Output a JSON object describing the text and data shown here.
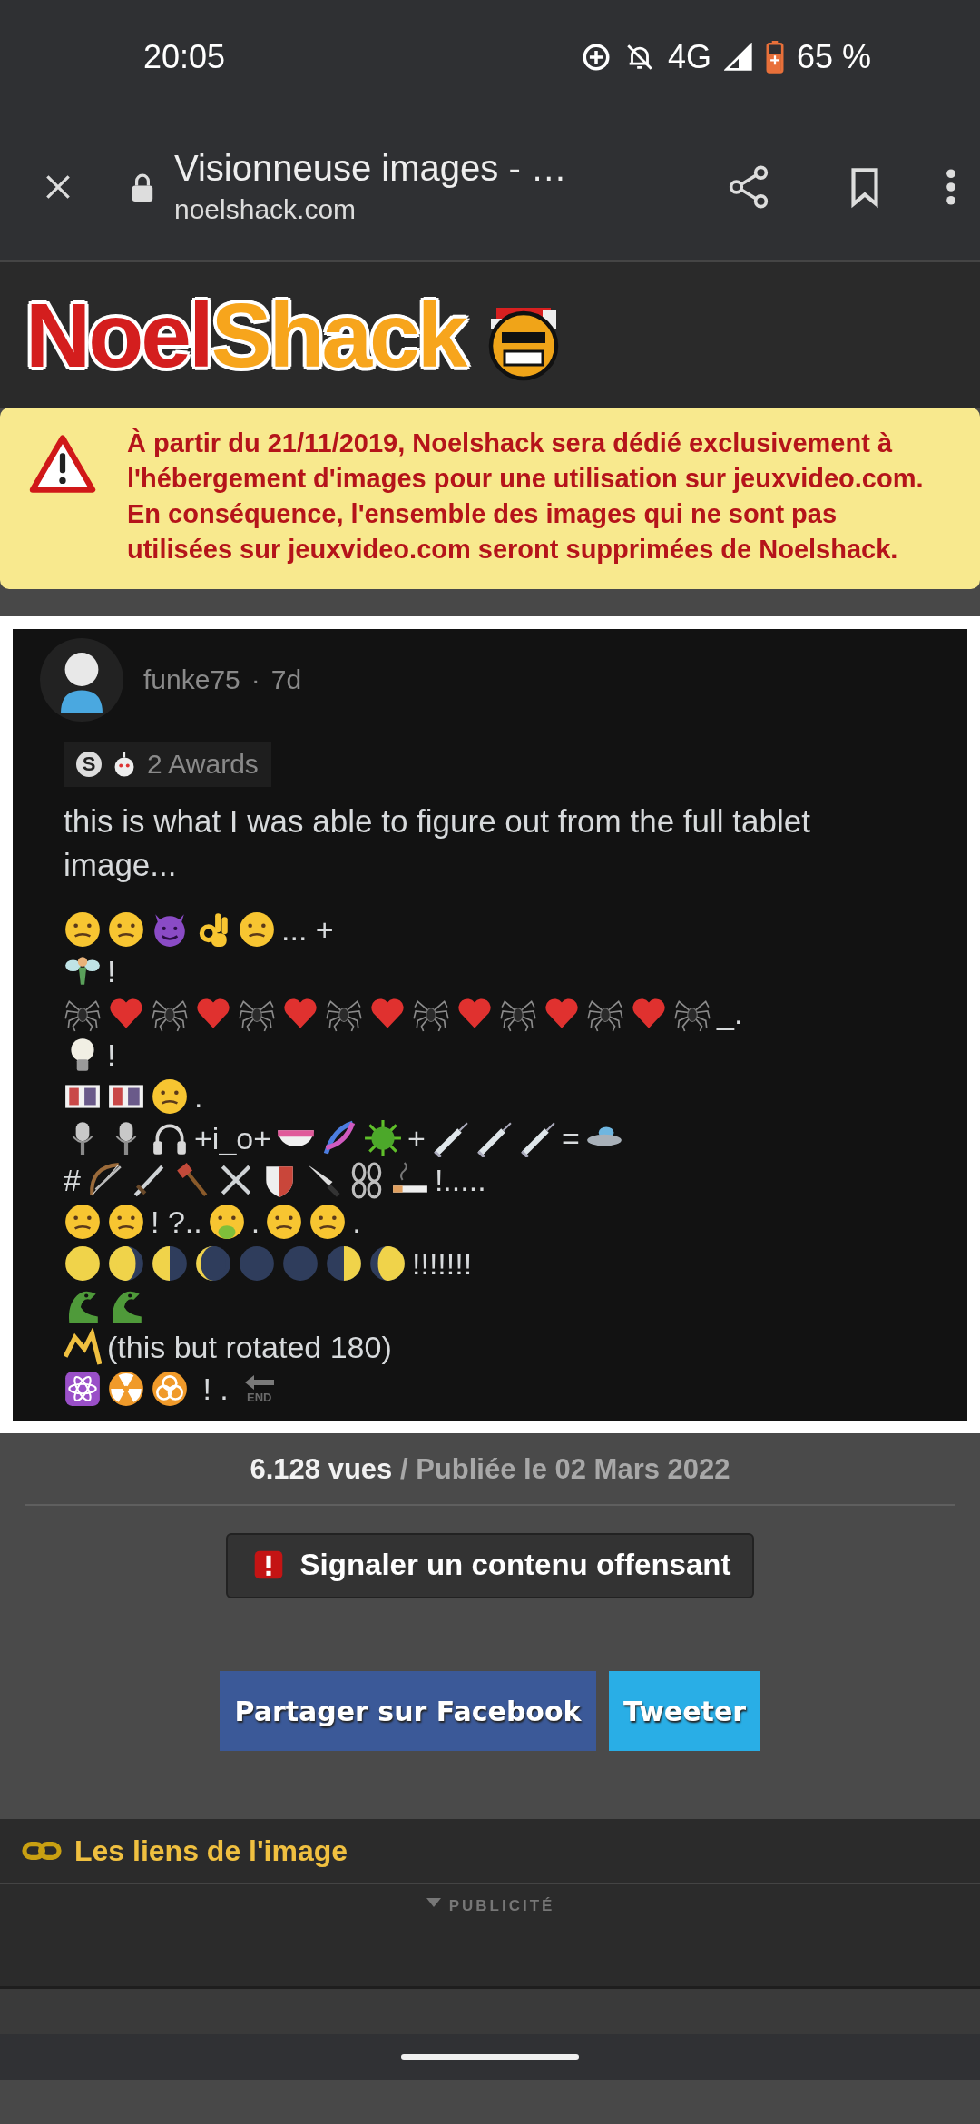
{
  "status_bar": {
    "time": "20:05",
    "network": "4G",
    "battery": "65 %"
  },
  "browser": {
    "title": "Visionneuse images - …",
    "url": "noelshack.com"
  },
  "logo": {
    "part_1": "Noel",
    "part_2": "Shack"
  },
  "notice": "À partir du 21/11/2019, Noelshack sera dédié exclusivement à l'hébergement d'images pour une utilisation sur jeuxvideo.com. En conséquence, l'ensemble des images qui ne sont pas utilisées sur jeuxvideo.com seront supprimées de Noelshack.",
  "post": {
    "author": "funke75",
    "separator": "·",
    "age": "7d",
    "award_coin": "S",
    "awards": "2 Awards",
    "text": "this is what I was able to figure out from the full tablet image...",
    "lines": [
      [
        {
          "kind": "face"
        },
        {
          "kind": "face"
        },
        {
          "kind": "devil"
        },
        {
          "kind": "hand"
        },
        {
          "kind": "face"
        },
        {
          "kind": "text",
          "text": "... +"
        }
      ],
      [
        {
          "kind": "fairy"
        },
        {
          "kind": "text",
          "text": "!"
        }
      ],
      [
        {
          "kind": "spider"
        },
        {
          "kind": "heart"
        },
        {
          "kind": "spider"
        },
        {
          "kind": "heart"
        },
        {
          "kind": "spider"
        },
        {
          "kind": "heart"
        },
        {
          "kind": "spider"
        },
        {
          "kind": "heart"
        },
        {
          "kind": "spider"
        },
        {
          "kind": "heart"
        },
        {
          "kind": "spider"
        },
        {
          "kind": "heart"
        },
        {
          "kind": "spider"
        },
        {
          "kind": "heart"
        },
        {
          "kind": "spider"
        },
        {
          "kind": "text",
          "text": "_."
        }
      ],
      [
        {
          "kind": "bulb"
        },
        {
          "kind": "text",
          "text": "!"
        }
      ],
      [
        {
          "kind": "card"
        },
        {
          "kind": "card"
        },
        {
          "kind": "face"
        },
        {
          "kind": "text",
          "text": "."
        }
      ],
      [
        {
          "kind": "mic"
        },
        {
          "kind": "mic"
        },
        {
          "kind": "headphones"
        },
        {
          "kind": "text",
          "text": "+i_o+"
        },
        {
          "kind": "bowl"
        },
        {
          "kind": "dna"
        },
        {
          "kind": "virus"
        },
        {
          "kind": "text",
          "text": "+"
        },
        {
          "kind": "syringe"
        },
        {
          "kind": "syringe"
        },
        {
          "kind": "syringe"
        },
        {
          "kind": "text",
          "text": "="
        },
        {
          "kind": "ufo"
        }
      ],
      [
        {
          "kind": "text",
          "text": "#"
        },
        {
          "kind": "bow"
        },
        {
          "kind": "sword"
        },
        {
          "kind": "axe"
        },
        {
          "kind": "swords"
        },
        {
          "kind": "shield"
        },
        {
          "kind": "knife"
        },
        {
          "kind": "chain"
        },
        {
          "kind": "cigarette"
        },
        {
          "kind": "text",
          "text": "!....."
        }
      ],
      [
        {
          "kind": "face"
        },
        {
          "kind": "face"
        },
        {
          "kind": "text",
          "text": "! ?.."
        },
        {
          "kind": "sickface"
        },
        {
          "kind": "text",
          "text": "."
        },
        {
          "kind": "face"
        },
        {
          "kind": "face"
        },
        {
          "kind": "text",
          "text": "."
        }
      ],
      [
        {
          "kind": "fullmoon"
        },
        {
          "kind": "waninggibbous"
        },
        {
          "kind": "lastquarter"
        },
        {
          "kind": "waningcrescent"
        },
        {
          "kind": "newmoon"
        },
        {
          "kind": "newmoon"
        },
        {
          "kind": "firstquarter"
        },
        {
          "kind": "waxinggibbous"
        },
        {
          "kind": "text",
          "text": "!!!!!!!"
        }
      ],
      [
        {
          "kind": "dragon"
        },
        {
          "kind": "dragon"
        }
      ],
      [
        {
          "kind": "zigzag"
        },
        {
          "kind": "text",
          "text": "(this but rotated 180)"
        }
      ],
      [
        {
          "kind": "atom"
        },
        {
          "kind": "radioactive"
        },
        {
          "kind": "biohazard"
        },
        {
          "kind": "text",
          "text": " ! ."
        },
        {
          "kind": "endarrow",
          "text": "END"
        }
      ]
    ]
  },
  "stats": {
    "views": "6.128 vues",
    "published": "/ Publiée le 02 Mars 2022"
  },
  "report_button": "Signaler un contenu offensant",
  "share_buttons": [
    {
      "kind": "facebook",
      "label": "Partager sur Facebook"
    },
    {
      "kind": "twitter",
      "label": "Tweeter"
    }
  ],
  "links_section": "Les liens de l'image",
  "ad_label": "PUBLICITÉ"
}
